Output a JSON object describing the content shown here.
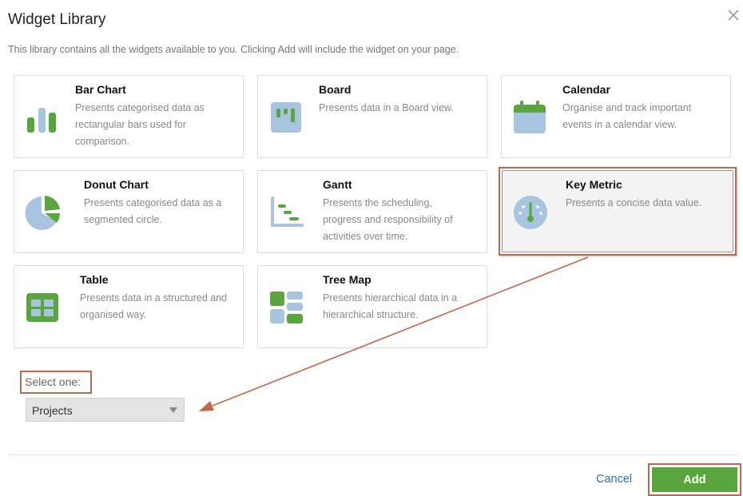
{
  "dialog": {
    "title": "Widget Library",
    "intro": "This library contains all the widgets available to you. Clicking Add will include the widget on your page."
  },
  "widgets": [
    {
      "title": "Bar Chart",
      "description": "Presents categorised data as rectangular bars used for comparison.",
      "icon": "bar-chart-icon"
    },
    {
      "title": "Board",
      "description": "Presents data in a Board view.",
      "icon": "board-icon"
    },
    {
      "title": "Calendar",
      "description": "Organise and track important events in a calendar view.",
      "icon": "calendar-icon"
    },
    {
      "title": "Donut Chart",
      "description": "Presents categorised data as a segmented circle.",
      "icon": "donut-chart-icon"
    },
    {
      "title": "Gantt",
      "description": "Presents the scheduling, progress and responsibility of activities over time.",
      "icon": "gantt-icon"
    },
    {
      "title": "Key Metric",
      "description": "Presents a concise data value.",
      "icon": "key-metric-icon",
      "selected": true
    },
    {
      "title": "Table",
      "description": "Presents data in a structured and organised way.",
      "icon": "table-icon"
    },
    {
      "title": "Tree Map",
      "description": "Presents hierarchical data in a hierarchical structure.",
      "icon": "tree-map-icon"
    }
  ],
  "select": {
    "label": "Select one:",
    "value": "Projects"
  },
  "footer": {
    "cancel_label": "Cancel",
    "add_label": "Add"
  },
  "colors": {
    "green": "#5aa63e",
    "blue": "#a9c4de",
    "highlight": "#c0674c",
    "link": "#2f6da9"
  }
}
